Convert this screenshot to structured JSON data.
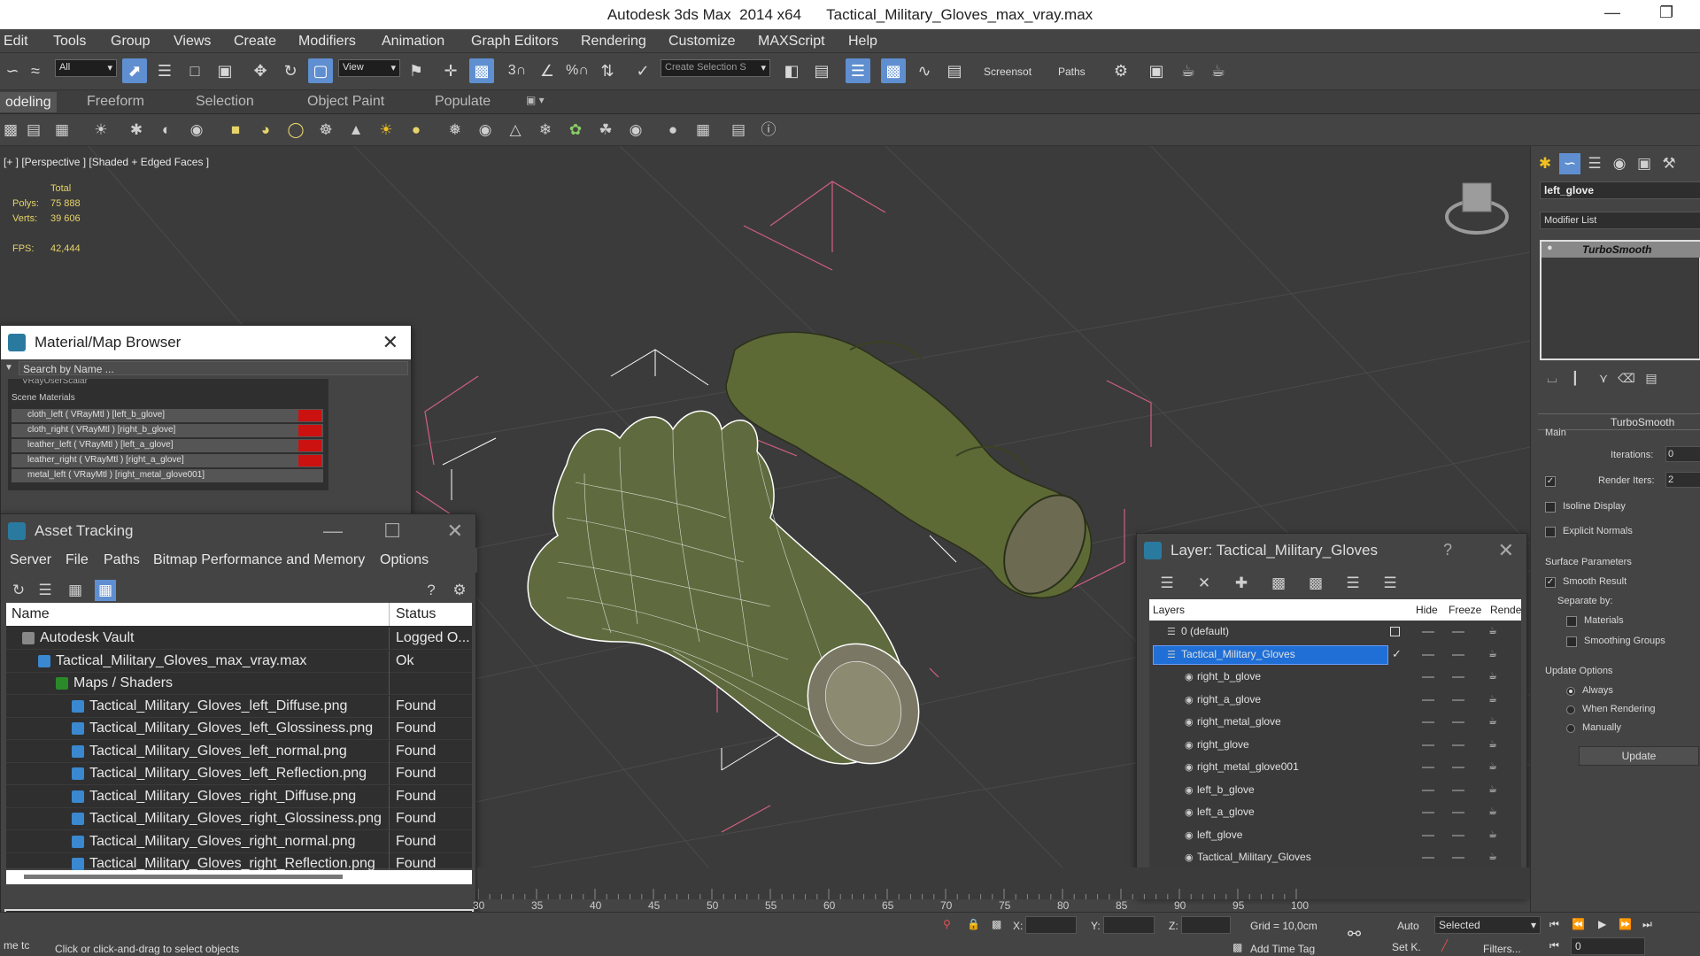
{
  "window": {
    "title": "Autodesk 3ds Max  2014 x64      Tactical_Military_Gloves_max_vray.max"
  },
  "menu": [
    "Edit",
    "Tools",
    "Group",
    "Views",
    "Create",
    "Modifiers",
    "Animation",
    "Graph Editors",
    "Rendering",
    "Customize",
    "MAXScript",
    "Help"
  ],
  "toolbar": {
    "filter_value": "All",
    "ref_coord_value": "View",
    "selection_set_placeholder": "Create Selection S",
    "screenshot_label": "Screensot",
    "paths_label": "Paths",
    "snap_angle": "3",
    "snap_percent": "%"
  },
  "ribbon": {
    "tabs": [
      "odeling",
      "Freeform",
      "Selection",
      "Object Paint",
      "Populate"
    ]
  },
  "viewport": {
    "label": "[+ ] [Perspective ] [Shaded + Edged Faces ]",
    "stats": {
      "total_label": "Total",
      "polys_label": "Polys:",
      "polys_value": "75 888",
      "verts_label": "Verts:",
      "verts_value": "39 606",
      "fps_label": "FPS:",
      "fps_value": "42,444"
    }
  },
  "material_browser": {
    "title": "Material/Map Browser",
    "search_placeholder": "Search by Name ...",
    "clipped_item": "VRayUserScalar",
    "section": "Scene Materials",
    "items": [
      "cloth_left  ( VRayMtl ) [left_b_glove]",
      "cloth_right  ( VRayMtl ) [right_b_glove]",
      "leather_left  ( VRayMtl ) [left_a_glove]",
      "leather_right  ( VRayMtl ) [right_a_glove]",
      "metal_left  ( VRayMtl ) [right_metal_glove001]"
    ]
  },
  "asset_tracking": {
    "title": "Asset Tracking",
    "menu": [
      "Server",
      "File",
      "Paths",
      "Bitmap Performance and Memory",
      "Options"
    ],
    "col_name": "Name",
    "col_status": "Status",
    "rows": [
      {
        "name": "Autodesk Vault",
        "status": "Logged O..."
      },
      {
        "name": "Tactical_Military_Gloves_max_vray.max",
        "status": "Ok"
      },
      {
        "name": "Maps / Shaders",
        "status": ""
      },
      {
        "name": "Tactical_Military_Gloves_left_Diffuse.png",
        "status": "Found"
      },
      {
        "name": "Tactical_Military_Gloves_left_Glossiness.png",
        "status": "Found"
      },
      {
        "name": "Tactical_Military_Gloves_left_normal.png",
        "status": "Found"
      },
      {
        "name": "Tactical_Military_Gloves_left_Reflection.png",
        "status": "Found"
      },
      {
        "name": "Tactical_Military_Gloves_right_Diffuse.png",
        "status": "Found"
      },
      {
        "name": "Tactical_Military_Gloves_right_Glossiness.png",
        "status": "Found"
      },
      {
        "name": "Tactical_Military_Gloves_right_normal.png",
        "status": "Found"
      },
      {
        "name": "Tactical_Military_Gloves_right_Reflection.png",
        "status": "Found"
      }
    ]
  },
  "layer_manager": {
    "title": "Layer: Tactical_Military_Gloves",
    "help": "?",
    "col_layers": "Layers",
    "col_hide": "Hide",
    "col_freeze": "Freeze",
    "col_render": "Rende",
    "layers": [
      "0 (default)",
      "Tactical_Military_Gloves",
      "right_b_glove",
      "right_a_glove",
      "right_metal_glove",
      "right_glove",
      "right_metal_glove001",
      "left_b_glove",
      "left_a_glove",
      "left_glove",
      "Tactical_Military_Gloves"
    ]
  },
  "command_panel": {
    "object_name": "left_glove",
    "modifier_list_label": "Modifier List",
    "stack_item": "TurboSmooth",
    "rollout_title": "TurboSmooth",
    "main_label": "Main",
    "iterations_label": "Iterations:",
    "iterations_value": "0",
    "render_iters_label": "Render Iters:",
    "render_iters_value": "2",
    "isoline_label": "Isoline Display",
    "explicit_normals_label": "Explicit Normals",
    "surface_params_label": "Surface Parameters",
    "smooth_result_label": "Smooth Result",
    "separate_by_label": "Separate by:",
    "materials_label": "Materials",
    "smoothing_groups_label": "Smoothing Groups",
    "update_options_label": "Update Options",
    "always_label": "Always",
    "when_rendering_label": "When Rendering",
    "manually_label": "Manually",
    "update_button": "Update"
  },
  "timeline": {
    "ticks": [
      "30",
      "35",
      "40",
      "45",
      "50",
      "55",
      "60",
      "65",
      "70",
      "75",
      "80",
      "85",
      "90",
      "95",
      "100"
    ]
  },
  "status": {
    "prompt": "Click or click-and-drag to select objects",
    "script_label": "me  tc",
    "x_label": "X:",
    "y_label": "Y:",
    "z_label": "Z:",
    "grid": "Grid = 10,0cm",
    "add_time_tag": "Add Time Tag",
    "auto_label": "Auto",
    "setk_label": "Set K.",
    "selected_value": "Selected",
    "filters_label": "Filters...",
    "frame_value": "0"
  },
  "colors": {
    "accent": "#5f8fd0",
    "stat_text": "#e6d36a",
    "selection": "#1f6fd6",
    "material_swatch": "#cc1111",
    "glove_green": "#6a7a3a"
  }
}
